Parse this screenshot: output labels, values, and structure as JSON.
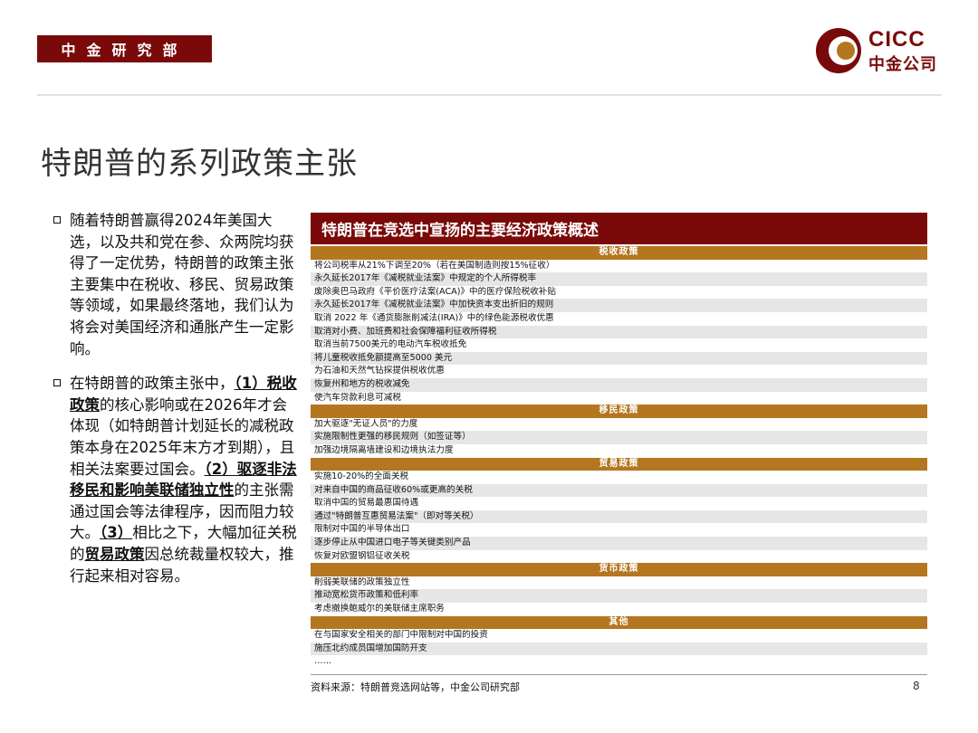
{
  "header": {
    "dept": "中金研究部",
    "logo_en": "CICC",
    "logo_cn": "中金公司",
    "brand_color": "#7a0a0a",
    "accent_color": "#b4761f"
  },
  "title": "特朗普的系列政策主张",
  "bullets": [
    {
      "segments": [
        {
          "text": "随着特朗普赢得2024年美国大选，以及共和党在参、众两院均获得了一定优势，特朗普的政策主张主要集中在税收、移民、贸易政策等领域，如果最终落地，我们认为将会对美国经济和通胀产生一定影响。",
          "em": false
        }
      ]
    },
    {
      "segments": [
        {
          "text": "在特朗普的政策主张中，",
          "em": false
        },
        {
          "text": "（1）税收政策",
          "em": true
        },
        {
          "text": "的核心影响或在2026年才会体现（如特朗普计划延长的减税政策本身在2025年末方才到期），且相关法案要过国会。",
          "em": false
        },
        {
          "text": "（2）驱逐非法移民和影响美联储独立性",
          "em": true
        },
        {
          "text": "的主张需通过国会等法律程序，因而阻力较大。",
          "em": false
        },
        {
          "text": "（3）",
          "em": true
        },
        {
          "text": "相比之下，大幅加征关税的",
          "em": false
        },
        {
          "text": "贸易政策",
          "em": true
        },
        {
          "text": "因总统裁量权较大，推行起来相对容易。",
          "em": false
        }
      ]
    }
  ],
  "table": {
    "title": "特朗普在竞选中宣扬的主要经济政策概述",
    "sections": [
      {
        "name": "税收政策",
        "rows": [
          "将公司税率从21%下调至20%（若在美国制造则按15%征收）",
          "永久延长2017年《减税就业法案》中规定的个人所得税率",
          "废除奥巴马政府《平价医疗法案(ACA)》中的医疗保险税收补贴",
          "永久延长2017年《减税就业法案》中加快资本支出折旧的规则",
          "取消 2022 年《通货膨胀削减法(IRA)》中的绿色能源税收优惠",
          "取消对小费、加班费和社会保障福利征收所得税",
          "取消当前7500美元的电动汽车税收抵免",
          "将儿童税收抵免额提高至5000 美元",
          "为石油和天然气钻探提供税收优惠",
          "恢复州和地方的税收减免",
          "使汽车贷款利息可减税"
        ]
      },
      {
        "name": "移民政策",
        "rows": [
          "加大驱逐\"无证人员\"的力度",
          "实施限制性更强的移民规则（如签证等）",
          "加强边境隔离墙建设和边境执法力度"
        ]
      },
      {
        "name": "贸易政策",
        "rows": [
          "实施10-20%的全面关税",
          "对来自中国的商品征收60%或更高的关税",
          "取消中国的贸易最惠国待遇",
          "通过\"特朗普互惠贸易法案\"（即对等关税）",
          "限制对中国的半导体出口",
          "逐步停止从中国进口电子等关键类别产品",
          "恢复对欧盟钢铝征收关税"
        ]
      },
      {
        "name": "货币政策",
        "rows": [
          "削弱美联储的政策独立性",
          "推动宽松货币政策和低利率",
          "考虑撤换鲍威尔的美联储主席职务"
        ]
      },
      {
        "name": "其他",
        "rows": [
          "在与国家安全相关的部门中限制对中国的投资",
          "施压北约成员国增加国防开支",
          "……"
        ]
      }
    ]
  },
  "source": "资料来源：特朗普竞选网站等，中金公司研究部",
  "page_number": "8"
}
